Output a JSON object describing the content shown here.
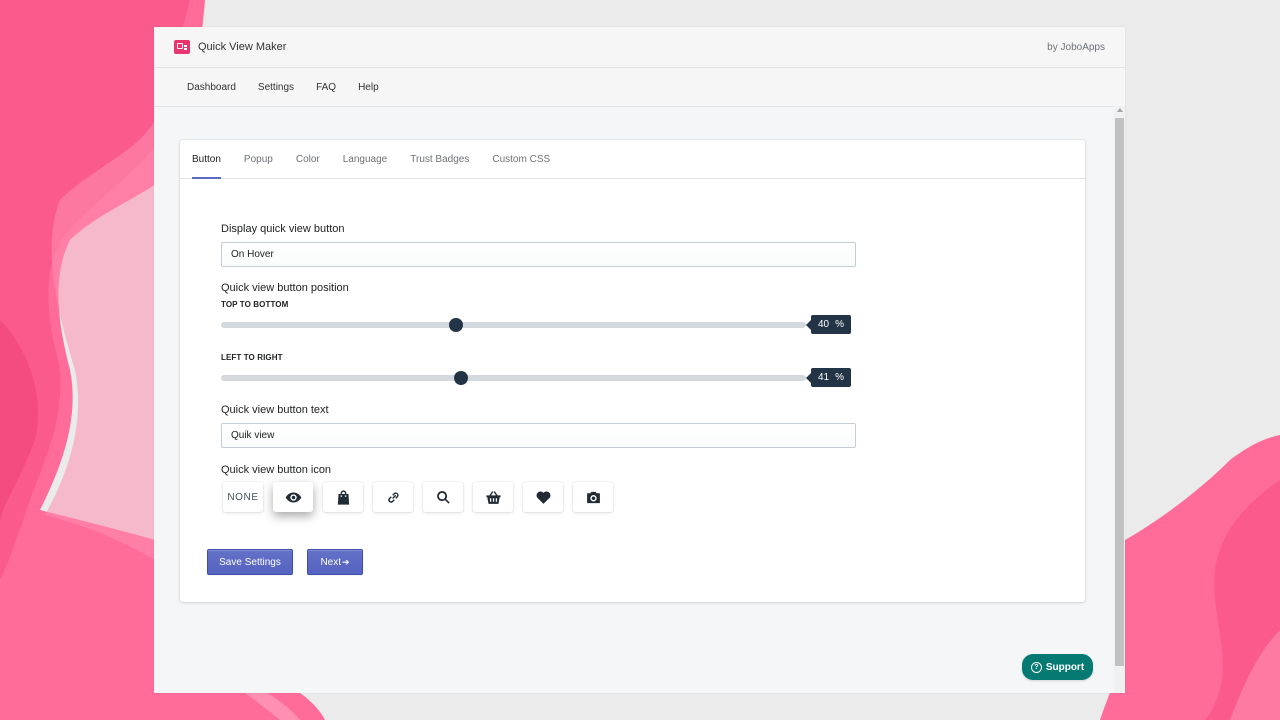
{
  "app": {
    "title": "Quick View Maker",
    "by_line": "by JoboApps"
  },
  "nav": [
    "Dashboard",
    "Settings",
    "FAQ",
    "Help"
  ],
  "tabs": [
    "Button",
    "Popup",
    "Color",
    "Language",
    "Trust Badges",
    "Custom CSS"
  ],
  "active_tab": "Button",
  "form": {
    "display_label": "Display quick view button",
    "display_value": "On Hover",
    "position_label": "Quick view button position",
    "top_bottom_label": "TOP TO BOTTOM",
    "top_bottom_value": "40",
    "left_right_label": "LEFT TO RIGHT",
    "left_right_value": "41",
    "percent_unit": "%",
    "text_label": "Quick view button text",
    "text_value": "Quik view",
    "icon_label": "Quick view button icon",
    "icon_none": "NONE",
    "icons": [
      "none",
      "eye-icon",
      "shopping-bag-icon",
      "link-icon",
      "search-icon",
      "basket-icon",
      "heart-icon",
      "camera-icon"
    ],
    "selected_icon": "eye-icon"
  },
  "buttons": {
    "save": "Save Settings",
    "next": "Next",
    "next_icon": "➔"
  },
  "support": {
    "label": "Support",
    "icon": "?"
  },
  "colors": {
    "accent": "#5c6ac4",
    "slider_dark": "#223446",
    "support": "#047a72",
    "pink": "#ff6a9a"
  }
}
